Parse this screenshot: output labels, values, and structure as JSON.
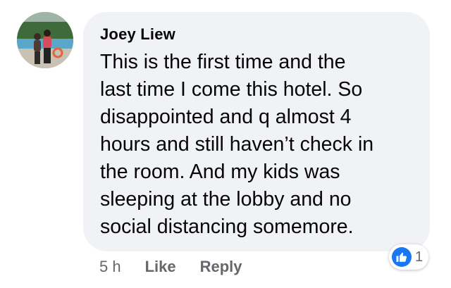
{
  "comment": {
    "author": "Joey Liew",
    "text": "This is the first time and the\nlast time I come this hotel.  So\ndisappointed and q almost 4\nhours and still haven’t check in\nthe room. And my kids was\nsleeping at the lobby and no\nsocial distancing somemore."
  },
  "actions": {
    "time": "5 h",
    "like_label": "Like",
    "reply_label": "Reply"
  },
  "reaction": {
    "icon": "like-thumbs-up-icon",
    "count": "1",
    "color": "#1877f2"
  },
  "colors": {
    "bubble": "#f0f2f5",
    "text": "#050505",
    "secondary": "#65676b"
  }
}
